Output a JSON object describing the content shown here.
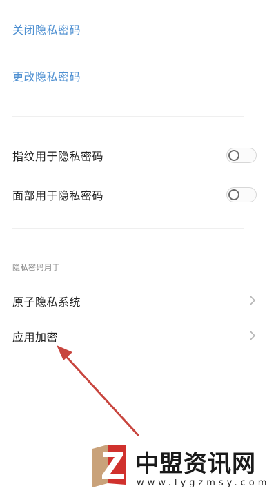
{
  "top_links": {
    "close_label": "关闭隐私密码",
    "change_label": "更改隐私密码"
  },
  "biometrics": {
    "fingerprint_label": "指纹用于隐私密码",
    "fingerprint_enabled": false,
    "face_label": "面部用于隐私密码",
    "face_enabled": false
  },
  "usage_section": {
    "header": "隐私密码用于",
    "items": [
      {
        "label": "原子隐私系统"
      },
      {
        "label": "应用加密"
      }
    ]
  },
  "watermark": {
    "brand": "中盟资讯网",
    "url": "www.lygzmsy.com"
  },
  "colors": {
    "link": "#4d8fd1",
    "annotation_arrow": "#c8453e"
  }
}
